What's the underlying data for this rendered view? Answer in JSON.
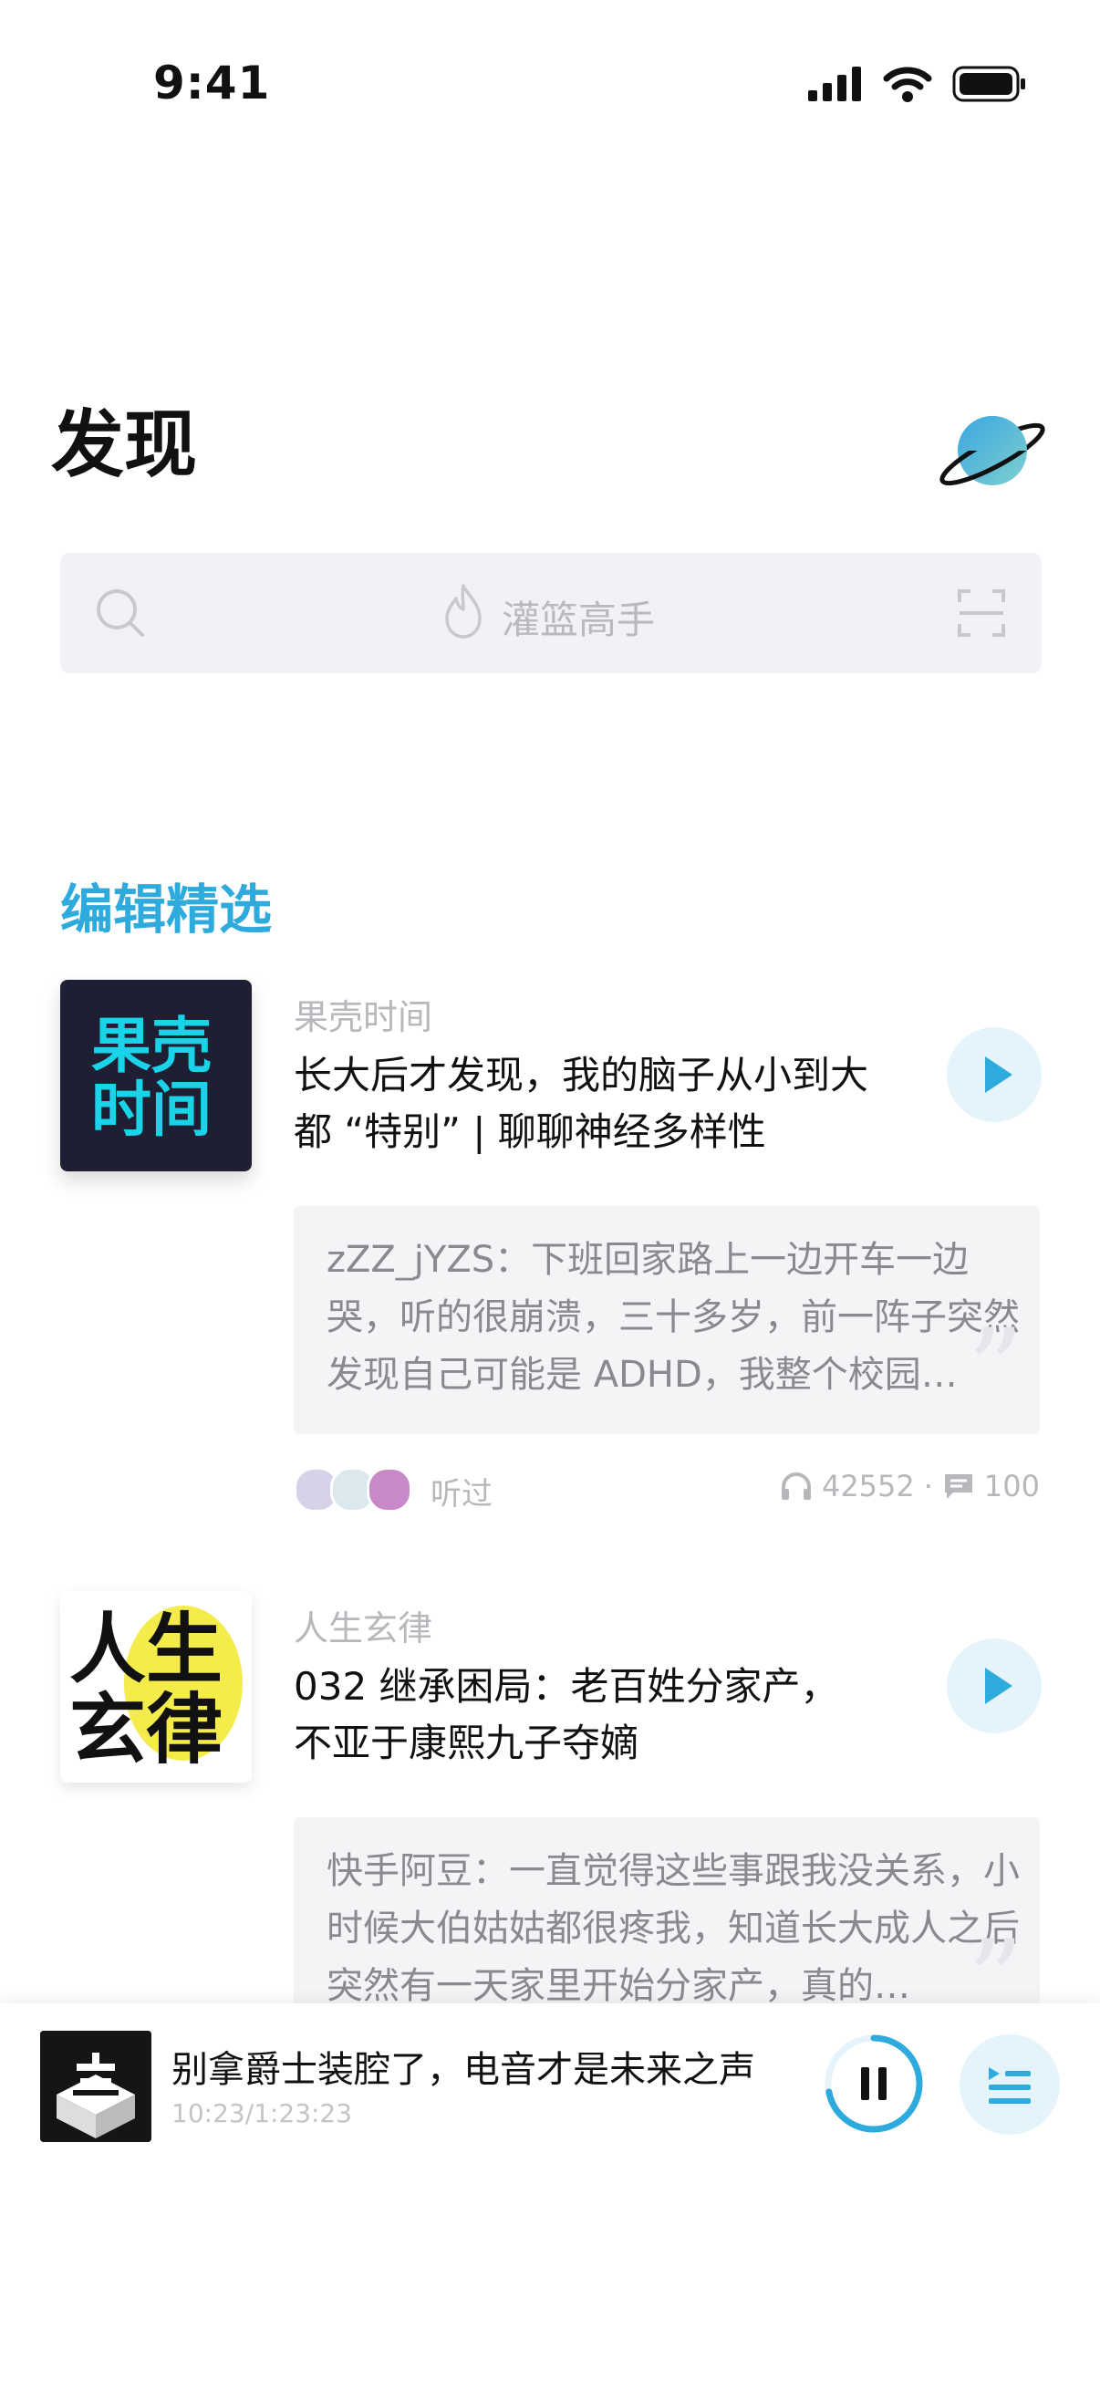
{
  "status_bar": {
    "time": "9:41"
  },
  "header": {
    "title": "发现"
  },
  "search": {
    "hot_keyword": "灌篮高手"
  },
  "section": {
    "title": "编辑精选"
  },
  "colors": {
    "accent": "#2eaadc",
    "play_bg": "#e5f4fb"
  },
  "feed": [
    {
      "cover_text": [
        "果壳",
        "时间"
      ],
      "podcast": "果壳时间",
      "title_lines": [
        "长大后才发现，我的脑子从小到大",
        "都 “特别” | 聊聊神经多样性"
      ],
      "comment": "zZZ_jYZS：下班回家路上一边开车一边哭，听的很崩溃，三十多岁，前一阵子突然发现自己可能是 ADHD，我整个校园…",
      "listened_label": "听过",
      "play_count": "42552",
      "comment_count": "100"
    },
    {
      "cover_text": [
        "人生",
        "玄律"
      ],
      "podcast": "人生玄律",
      "title_lines": [
        "032 继承困局：老百姓分家产，",
        "不亚于康熙九子夺嫡"
      ],
      "comment": "快手阿豆：一直觉得这些事跟我没关系，小时候大伯姑姑都很疼我，知道长大成人之后突然有一天家里开始分家产，真的…"
    }
  ],
  "player": {
    "title": "别拿爵士装腔了，电音才是未来之声",
    "time": "10:23/1:23:23",
    "progress": 0.72
  }
}
